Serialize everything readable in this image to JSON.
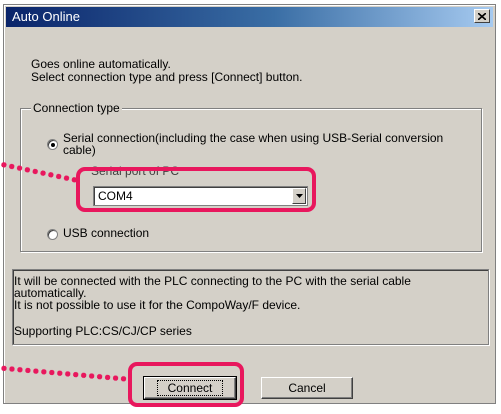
{
  "window": {
    "title": "Auto Online",
    "close_symbol": "×"
  },
  "intro": {
    "line1": "Goes online automatically.",
    "line2": "Select connection type and press [Connect] button."
  },
  "connection_type": {
    "legend": "Connection type",
    "serial_label_line1": "Serial connection(including the case when using USB-Serial conversion",
    "serial_label_line2": "cable)",
    "serial_selected": true,
    "serial_port_label": "Serial port of PC",
    "serial_port_value": "COM4",
    "usb_label": "USB connection",
    "usb_selected": false
  },
  "info": {
    "line1": "It will be connected with the PLC connecting to the PC with the serial cable",
    "line2": "automatically.",
    "line3": "It is not possible to use it for the CompoWay/F device.",
    "line4": "Supporting PLC:CS/CJ/CP series"
  },
  "buttons": {
    "connect": "Connect",
    "cancel": "Cancel"
  },
  "colors": {
    "highlight": "#e8175d",
    "dialog_bg": "#d4d0c8",
    "titlebar": "#0a246a"
  }
}
